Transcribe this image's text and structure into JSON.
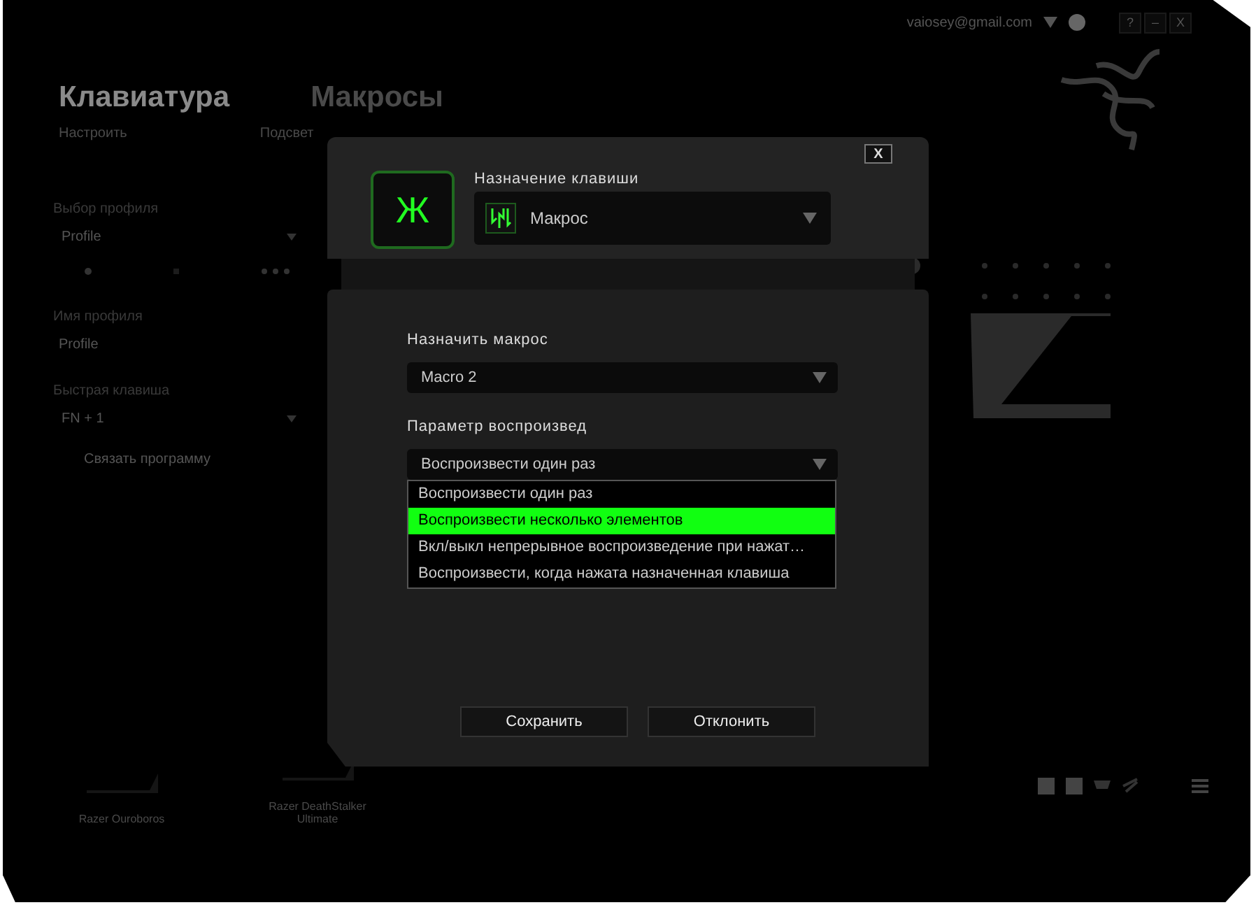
{
  "top_bar": {
    "account": "vaiosey@gmail.com",
    "controls": [
      "?",
      "–",
      "X"
    ]
  },
  "nav": {
    "tabs": [
      {
        "label": "Клавиатура",
        "selected": true
      },
      {
        "label": "Макросы",
        "selected": false
      }
    ],
    "subtabs": [
      {
        "label": "Настроить"
      },
      {
        "label": "Подсвет"
      }
    ]
  },
  "sidebar": {
    "profile_label": "Выбор профиля",
    "profile_value": "Profile",
    "name_label": "Имя профиля",
    "name_value": "Profile",
    "hotkey_label": "Быстрая клавиша",
    "hotkey_value": "FN + 1",
    "link": "Связать программу"
  },
  "devices": [
    {
      "name": "Razer Ouroboros"
    },
    {
      "name": "Razer DeathStalker Ultimate"
    }
  ],
  "dialog": {
    "close": "X",
    "key": "Ж",
    "assignment_label": "Назначение клавиши",
    "assignment_value": "Макрос",
    "macro_label": "Назначить макрос",
    "macro_value": "Macro 2",
    "playback_label": "Параметр воспроизвед",
    "playback_value": "Воспроизвести один раз",
    "options": [
      {
        "label": "Воспроизвести один раз",
        "selected": false
      },
      {
        "label": "Воспроизвести несколько элементов",
        "selected": true
      },
      {
        "label": "Вкл/выкл непрерывное воспроизведение при нажат…",
        "selected": false
      },
      {
        "label": "Воспроизвести, когда нажата назначенная клавиша",
        "selected": false
      }
    ],
    "buttons": [
      "Сохранить",
      "Отклонить"
    ]
  }
}
